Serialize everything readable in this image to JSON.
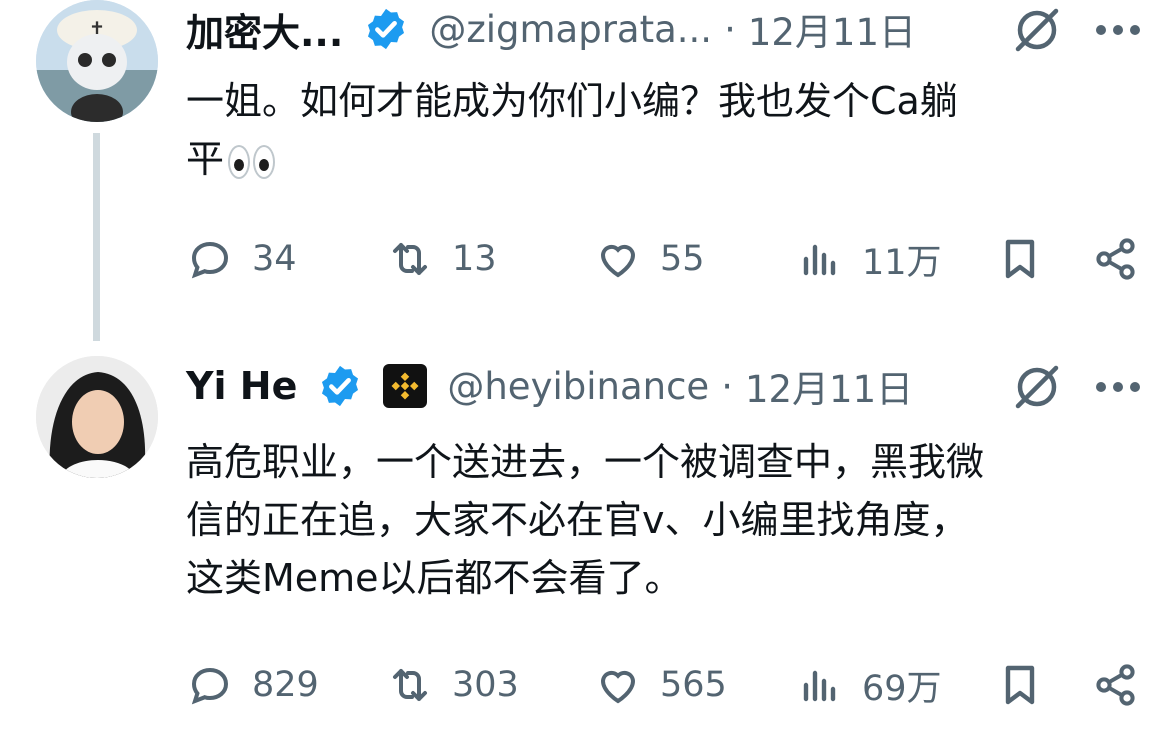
{
  "tweets": [
    {
      "author_name": "加密大...",
      "handle": "@zigmaprata...",
      "separator": "·",
      "date": "12月11日",
      "verified_color": "#1d9bf0",
      "text_line1": "一姐。如何才能成为你们小编？我也发个Ca躺",
      "text_line2": "平",
      "emoji": "eyes",
      "stats": {
        "replies": "34",
        "reposts": "13",
        "likes": "55",
        "views": "11万"
      }
    },
    {
      "author_name": "Yi He",
      "handle": "@heyibinance",
      "separator": "·",
      "date": "12月11日",
      "verified_color": "#1d9bf0",
      "affiliate_badge": "binance-logo",
      "affiliate_color": "#f3ba2f",
      "text_line1": "高危职业，一个送进去，一个被调查中，黑我微",
      "text_line2": "信的正在追，大家不必在官v、小编里找角度，",
      "text_line3": "这类Meme以后都不会看了。",
      "stats": {
        "replies": "829",
        "reposts": "303",
        "likes": "565",
        "views": "69万"
      }
    }
  ],
  "icons": [
    "reply-icon",
    "repost-icon",
    "like-icon",
    "views-icon",
    "bookmark-icon",
    "share-icon",
    "grok-icon",
    "more-icon"
  ],
  "colors": {
    "text": "#0f1419",
    "secondary": "#536471",
    "thread_line": "#cfd9de"
  }
}
